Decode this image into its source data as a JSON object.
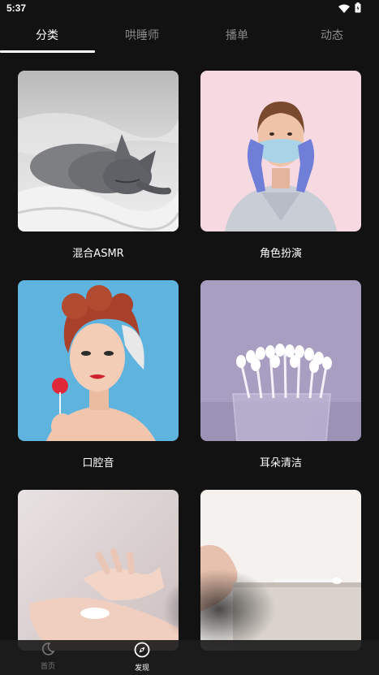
{
  "status_bar": {
    "time": "5:37",
    "icons": [
      "wifi-icon",
      "battery-icon"
    ]
  },
  "tabs": [
    {
      "label": "分类",
      "active": true
    },
    {
      "label": "哄睡师",
      "active": false
    },
    {
      "label": "播单",
      "active": false
    },
    {
      "label": "动态",
      "active": false
    }
  ],
  "categories": [
    {
      "label": "混合ASMR",
      "image": "sleeping-gray-cat"
    },
    {
      "label": "角色扮演",
      "image": "woman-in-mask-and-gloves"
    },
    {
      "label": "口腔音",
      "image": "woman-with-lollipop"
    },
    {
      "label": "耳朵清洁",
      "image": "cotton-swabs-in-glass"
    },
    {
      "label": "",
      "image": "hands-with-lotion"
    },
    {
      "label": "",
      "image": "hand-with-cotton-swab"
    }
  ],
  "bottom_nav": [
    {
      "label": "首页",
      "icon": "moon-icon",
      "active": false
    },
    {
      "label": "发现",
      "icon": "compass-icon",
      "active": true
    }
  ],
  "colors": {
    "background": "#121212",
    "tab_active": "#ffffff",
    "tab_inactive": "#8a8a8a",
    "nav_bar": "#1c1c1c"
  }
}
